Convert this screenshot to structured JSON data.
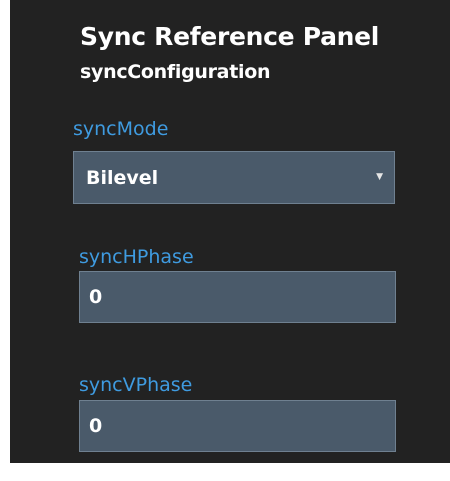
{
  "panel": {
    "title": "Sync Reference Panel",
    "subtitle": "syncConfiguration"
  },
  "fields": {
    "sync_mode": {
      "label": "syncMode",
      "selected": "Bilevel",
      "caret_icon": "caret-down-icon"
    },
    "sync_h_phase": {
      "label": "syncHPhase",
      "value": "0"
    },
    "sync_v_phase": {
      "label": "syncVPhase",
      "value": "0"
    }
  },
  "colors": {
    "panel_background": "#222222",
    "label_accent": "#3f9be0",
    "field_background": "#4a5a6a",
    "field_border": "#6f8090",
    "text": "#ffffff"
  }
}
